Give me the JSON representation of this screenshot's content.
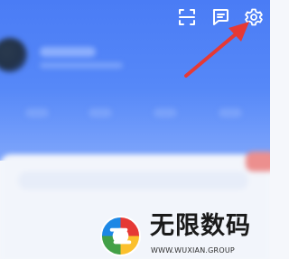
{
  "toolbar": {
    "icons": [
      "scan-icon",
      "message-icon",
      "gear-icon"
    ],
    "icon_color": "#ffffff"
  },
  "annotation": {
    "arrow_color": "#e53935"
  },
  "watermark": {
    "title": "无限数码",
    "url": "WWW.WUXIAN.GROUP",
    "logo_colors": [
      "#e53935",
      "#fbc02d",
      "#1e88e5",
      "#43a047"
    ]
  },
  "theme": {
    "header_color": "#4a7cf5",
    "body_color": "#f2f5fb"
  }
}
